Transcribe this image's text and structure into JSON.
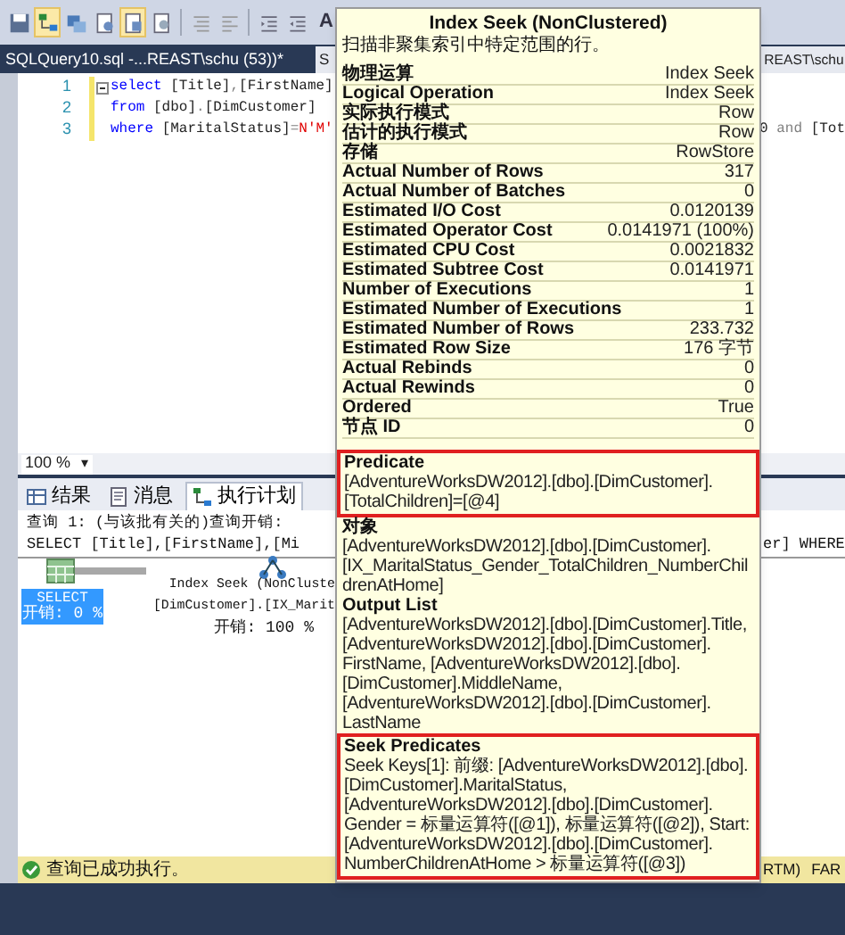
{
  "toolbar": {
    "buttons": [
      {
        "selected": false
      },
      {
        "selected": true
      },
      {
        "selected": false
      },
      {
        "selected": false
      },
      {
        "selected": true
      },
      {
        "selected": false
      },
      {
        "selected": false
      },
      {
        "selected": false
      },
      {
        "selected": false
      },
      {
        "selected": false
      },
      {
        "selected": false,
        "label": "A"
      }
    ]
  },
  "document_tabs": [
    {
      "label": "SQLQuery10.sql -...REAST\\schu (53))*",
      "selected": false
    },
    {
      "label_start": "S",
      "label_end": "REAST\\schu",
      "selected": true
    }
  ],
  "editor": {
    "lines": [
      {
        "number": "1",
        "collapsible": true,
        "tokens": [
          {
            "text": "select",
            "kind": "keyword"
          },
          {
            "text": " [Title]",
            "kind": "plain"
          },
          {
            "text": ",",
            "kind": "operator"
          },
          {
            "text": "[FirstName]",
            "kind": "plain"
          }
        ]
      },
      {
        "number": "2",
        "collapsible": false,
        "tokens": [
          {
            "text": "from",
            "kind": "keyword"
          },
          {
            "text": " [dbo]",
            "kind": "plain"
          },
          {
            "text": ".",
            "kind": "operator"
          },
          {
            "text": "[DimCustomer]",
            "kind": "plain"
          }
        ]
      },
      {
        "number": "3",
        "collapsible": false,
        "tokens": [
          {
            "text": "where",
            "kind": "keyword"
          },
          {
            "text": " [MaritalStatus]",
            "kind": "plain"
          },
          {
            "text": "=",
            "kind": "operator"
          },
          {
            "text": "N'M'",
            "kind": "string"
          }
        ],
        "tail": [
          {
            "text": "0 ",
            "kind": "plain"
          },
          {
            "text": "and",
            "kind": "operator"
          },
          {
            "text": " [Tot",
            "kind": "plain"
          }
        ]
      }
    ]
  },
  "zoom": {
    "value": "100 %",
    "arrow": "▾"
  },
  "result_tabs": [
    {
      "label": "结果",
      "selected": false
    },
    {
      "label": "消息",
      "selected": false
    },
    {
      "label": "执行计划",
      "selected": true
    }
  ],
  "plan": {
    "header_lines": [
      {
        "text": "查询 1: (与该批有关的)查询开销:"
      },
      {
        "text": "SELECT [Title],[FirstName],[Mi",
        "tail": "er] WHERE"
      }
    ],
    "nodes": [
      {
        "kind": "select",
        "lines": [
          "SELECT",
          "开销: 0 %"
        ],
        "selected": true
      },
      {
        "kind": "seek",
        "lines": [
          "Index Seek (NonCluste",
          "[DimCustomer].[IX_Marit",
          "开销: 100 %"
        ],
        "selected": false
      }
    ]
  },
  "status_bar": {
    "message": "查询已成功执行。",
    "right": [
      "RTM)",
      "FAR"
    ]
  },
  "tooltip": {
    "title": "Index Seek (NonClustered)",
    "description": "扫描非聚集索引中特定范围的行。",
    "rows": [
      {
        "label": "物理运算",
        "value": "Index Seek"
      },
      {
        "label": "Logical Operation",
        "value": "Index Seek"
      },
      {
        "label": "实际执行模式",
        "value": "Row"
      },
      {
        "label": "估计的执行模式",
        "value": "Row"
      },
      {
        "label": "存储",
        "value": "RowStore"
      },
      {
        "label": "Actual Number of Rows",
        "value": "317"
      },
      {
        "label": "Actual Number of Batches",
        "value": "0"
      },
      {
        "label": "Estimated I/O Cost",
        "value": "0.0120139"
      },
      {
        "label": "Estimated Operator Cost",
        "value": "0.0141971 (100%)"
      },
      {
        "label": "Estimated CPU Cost",
        "value": "0.0021832"
      },
      {
        "label": "Estimated Subtree Cost",
        "value": "0.0141971"
      },
      {
        "label": "Number of Executions",
        "value": "1"
      },
      {
        "label": "Estimated Number of Executions",
        "value": "1"
      },
      {
        "label": "Estimated Number of Rows",
        "value": "233.732"
      },
      {
        "label": "Estimated Row Size",
        "value": "176 字节"
      },
      {
        "label": "Actual Rebinds",
        "value": "0"
      },
      {
        "label": "Actual Rewinds",
        "value": "0"
      },
      {
        "label": "Ordered",
        "value": "True"
      },
      {
        "label": "节点 ID",
        "value": "0"
      }
    ],
    "sections": [
      {
        "heading": "Predicate",
        "text": "[AdventureWorksDW2012].[dbo].[DimCustomer].[TotalChildren]=[@4]",
        "highlighted": true
      },
      {
        "heading": "对象",
        "text": "[AdventureWorksDW2012].[dbo].[DimCustomer].[IX_MaritalStatus_Gender_TotalChildren_NumberChildrenAtHome]",
        "highlighted": false
      },
      {
        "heading": "Output List",
        "text": "[AdventureWorksDW2012].[dbo].[DimCustomer].Title, [AdventureWorksDW2012].[dbo].[DimCustomer].FirstName, [AdventureWorksDW2012].[dbo].[DimCustomer].MiddleName, [AdventureWorksDW2012].[dbo].[DimCustomer].LastName",
        "highlighted": false
      },
      {
        "heading": "Seek Predicates",
        "text": "Seek Keys[1]: 前缀: [AdventureWorksDW2012].[dbo].[DimCustomer].MaritalStatus, [AdventureWorksDW2012].[dbo].[DimCustomer].Gender = 标量运算符([@1]), 标量运算符([@2]), Start: [AdventureWorksDW2012].[dbo].[DimCustomer].NumberChildrenAtHome  > 标量运算符([@3])",
        "highlighted": true
      }
    ]
  }
}
